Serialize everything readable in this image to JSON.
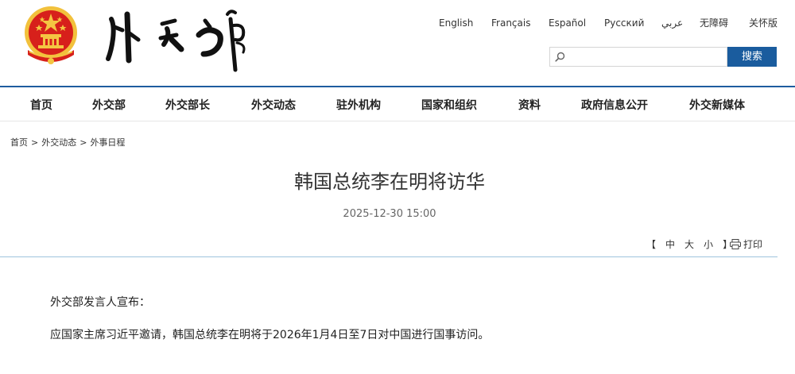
{
  "header": {
    "logo_text": "外交部",
    "languages": [
      "English",
      "Français",
      "Español",
      "Русский",
      "عربي",
      "无障碍",
      "关怀版"
    ],
    "search": {
      "placeholder": "",
      "button_label": "搜索"
    }
  },
  "nav": {
    "items": [
      "首页",
      "外交部",
      "外交部长",
      "外交动态",
      "驻外机构",
      "国家和组织",
      "资料",
      "政府信息公开",
      "外交新媒体"
    ]
  },
  "breadcrumb": {
    "items": [
      "首页",
      "外交动态",
      "外事日程"
    ],
    "separator": ">"
  },
  "article": {
    "title": "韩国总统李在明将访华",
    "timestamp": "2025-12-30 15:00",
    "font_size_label_open": "【",
    "font_size_options": [
      "中",
      "大",
      "小"
    ],
    "font_size_label_close": "】",
    "print_label": "打印",
    "paragraphs": [
      "外交部发言人宣布：",
      "应国家主席习近平邀请，韩国总统李在明将于2026年1月4日至7日对中国进行国事访问。"
    ]
  },
  "colors": {
    "accent_blue": "#1a5c9e",
    "header_rule": "#1e5d9f",
    "emblem_red": "#d7201b",
    "emblem_gold": "#f3c03a"
  },
  "icons": {
    "emblem": "national-emblem-icon",
    "search": "search-icon",
    "print": "printer-icon"
  }
}
